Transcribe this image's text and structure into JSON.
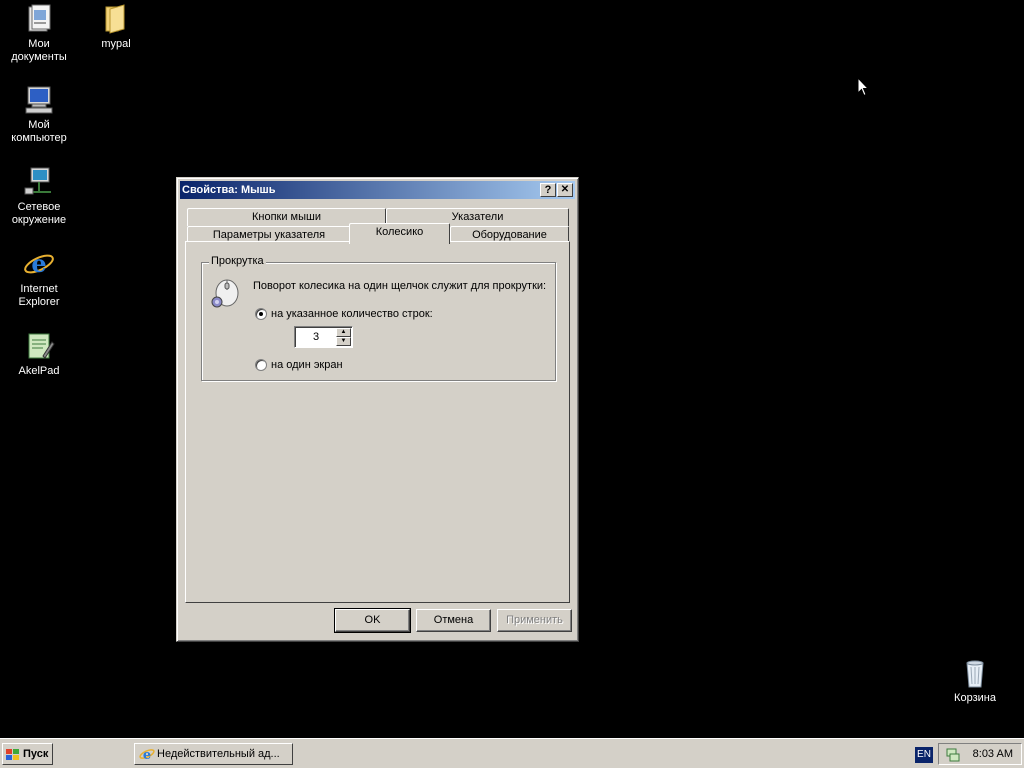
{
  "desktop": {
    "icons": [
      {
        "label": "Мои документы",
        "icon": "my-documents-icon"
      },
      {
        "label": "mypal",
        "icon": "folder-icon"
      },
      {
        "label": "Мой компьютер",
        "icon": "my-computer-icon"
      },
      {
        "label": "Сетевое окружение",
        "icon": "network-icon"
      },
      {
        "label": "Internet Explorer",
        "icon": "internet-explorer-icon"
      },
      {
        "label": "AkelPad",
        "icon": "akelpad-icon"
      },
      {
        "label": "Корзина",
        "icon": "recycle-bin-icon"
      }
    ]
  },
  "dialog": {
    "title": "Свойства: Мышь",
    "help_glyph": "?",
    "close_glyph": "✕",
    "tabs_row1": [
      "Кнопки мыши",
      "Указатели"
    ],
    "tabs_row2": [
      "Параметры указателя",
      "Колесико",
      "Оборудование"
    ],
    "active_tab": "Колесико",
    "group": {
      "label": "Прокрутка",
      "description": "Поворот колесика на один щелчок служит для прокрутки:",
      "option_lines": "на указанное количество строк:",
      "option_screen": "на один экран",
      "selected": "lines",
      "lines_value": "3"
    },
    "buttons": {
      "ok": "OK",
      "cancel": "Отмена",
      "apply": "Применить"
    }
  },
  "taskbar": {
    "start_label": "Пуск",
    "task_item": "Недействительный ад...",
    "language": "EN",
    "clock": "8:03 AM"
  },
  "colors": {
    "desktop_bg": "#000000",
    "face": "#d4d0c8",
    "title_start": "#0a246a",
    "title_end": "#a6caf0"
  }
}
